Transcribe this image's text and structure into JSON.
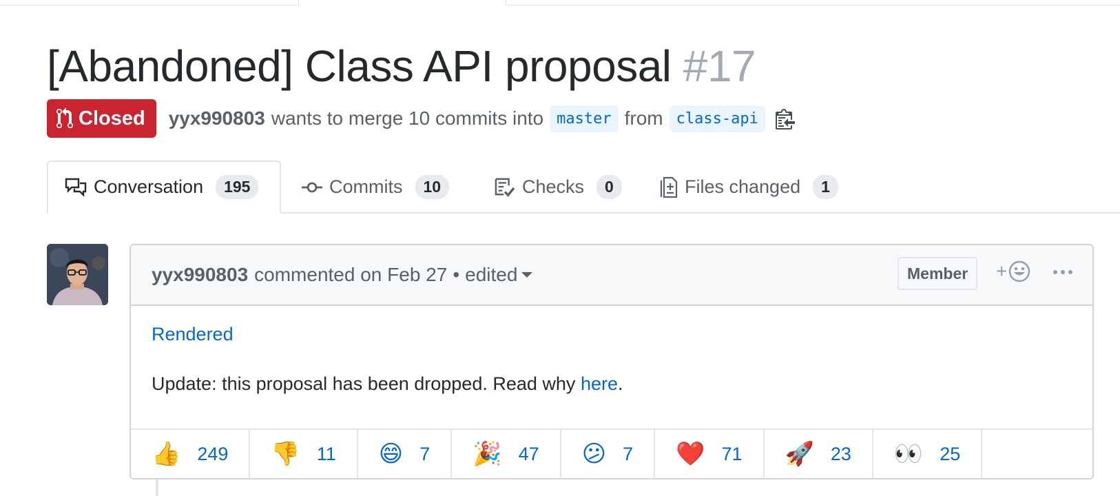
{
  "pr": {
    "title": "[Abandoned] Class API proposal",
    "number": "#17",
    "state": "Closed",
    "author": "yyx990803",
    "merge_text": "wants to merge 10 commits into",
    "base_branch": "master",
    "from_text": "from",
    "head_branch": "class-api"
  },
  "tabs": [
    {
      "label": "Conversation",
      "count": "195",
      "icon": "comment-discussion-icon"
    },
    {
      "label": "Commits",
      "count": "10",
      "icon": "git-commit-icon"
    },
    {
      "label": "Checks",
      "count": "0",
      "icon": "checklist-icon"
    },
    {
      "label": "Files changed",
      "count": "1",
      "icon": "diff-icon"
    }
  ],
  "comment": {
    "author": "yyx990803",
    "action": "commented on Feb 27",
    "separator": "•",
    "edited": "edited",
    "badge": "Member",
    "body": {
      "link_rendered": "Rendered",
      "update_text": "Update: this proposal has been dropped. Read why",
      "link_here": "here",
      "trailing": "."
    }
  },
  "reactions": [
    {
      "emoji": "👍",
      "count": "249",
      "name": "thumbs-up"
    },
    {
      "emoji": "👎",
      "count": "11",
      "name": "thumbs-down"
    },
    {
      "emoji": "😄",
      "count": "7",
      "name": "laugh"
    },
    {
      "emoji": "🎉",
      "count": "47",
      "name": "hooray"
    },
    {
      "emoji": "😕",
      "count": "7",
      "name": "confused"
    },
    {
      "emoji": "❤️",
      "count": "71",
      "name": "heart"
    },
    {
      "emoji": "🚀",
      "count": "23",
      "name": "rocket"
    },
    {
      "emoji": "👀",
      "count": "25",
      "name": "eyes"
    }
  ],
  "colors": {
    "closed": "#cb2431",
    "link": "#0366d6",
    "muted": "#586069",
    "border": "#d1d5da"
  }
}
